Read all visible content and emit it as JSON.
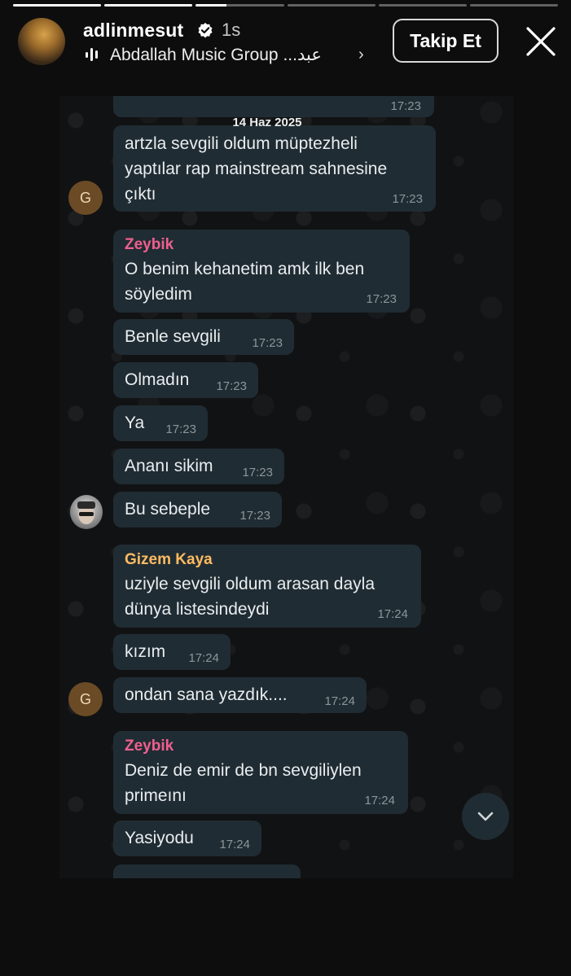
{
  "story": {
    "username": "adlinmesut",
    "time": "1s",
    "music_label": "Abdallah Music Group ...عبد",
    "follow_label": "Takip Et",
    "progress": {
      "segments": 6,
      "completed": 2,
      "current_fraction": 0.35
    }
  },
  "chat": {
    "date_separator": "14 Haz 2025",
    "messages": [
      {
        "time": "17:23"
      },
      {
        "lines": [
          "artzla sevgili oldum müptezheli",
          "yaptılar rap mainstream sahnesine",
          "çıktı"
        ],
        "time": "17:23"
      },
      {
        "sender": "Zeybik",
        "lines": [
          "O benim kehanetim amk ilk ben",
          "söyledim"
        ],
        "time": "17:23"
      },
      {
        "lines": [
          "Benle sevgili"
        ],
        "time": "17:23"
      },
      {
        "lines": [
          "Olmadın"
        ],
        "time": "17:23"
      },
      {
        "lines": [
          "Ya"
        ],
        "time": "17:23"
      },
      {
        "lines": [
          "Ananı sikim"
        ],
        "time": "17:23"
      },
      {
        "lines": [
          "Bu sebeple"
        ],
        "time": "17:23"
      },
      {
        "sender": "Gizem Kaya",
        "lines": [
          "uziyle sevgili oldum arasan dayla",
          "dünya listesindeydi"
        ],
        "time": "17:24"
      },
      {
        "lines": [
          "kızım"
        ],
        "time": "17:24"
      },
      {
        "lines": [
          "ondan sana yazdık...."
        ],
        "time": "17:24"
      },
      {
        "sender": "Zeybik",
        "lines": [
          "Deniz de emir de bn sevgiliylen",
          "primeını"
        ],
        "time": "17:24"
      },
      {
        "lines": [
          "Yasiyodu"
        ],
        "time": "17:24"
      }
    ],
    "avatars": {
      "initial": "G"
    }
  },
  "colors": {
    "bubble": "#202c33",
    "sender_zeybik": "#ef5f8e",
    "sender_gizem": "#ffbb60",
    "background": "#0d0d0d"
  },
  "icons": [
    "verified-badge-icon",
    "music-bars-icon",
    "chevron-right-icon",
    "close-icon",
    "chevron-down-icon"
  ]
}
